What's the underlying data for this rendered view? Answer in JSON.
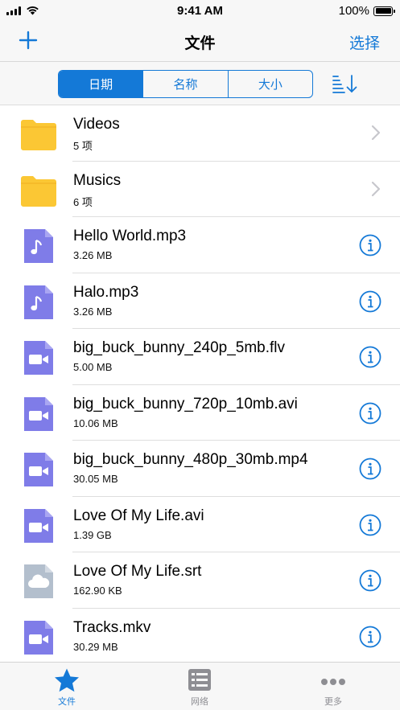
{
  "status_bar": {
    "time": "9:41 AM",
    "battery": "100%"
  },
  "nav": {
    "title": "文件",
    "select_label": "选择",
    "add_icon": "plus-icon"
  },
  "segments": {
    "items": [
      "日期",
      "名称",
      "大小"
    ],
    "active": 0
  },
  "colors": {
    "accent": "#1479d7",
    "folder": "#fbc734",
    "file_purple": "#7f7ce8",
    "subtitle_gray": "#b3bfcd",
    "tab_inactive": "#8e8e93"
  },
  "files": [
    {
      "name": "Videos",
      "detail": "5 项",
      "icon": "folder-icon",
      "action": "chevron-right-icon"
    },
    {
      "name": "Musics",
      "detail": "6 项",
      "icon": "folder-icon",
      "action": "chevron-right-icon"
    },
    {
      "name": "Hello World.mp3",
      "detail": "3.26 MB",
      "icon": "music-file-icon",
      "action": "info-icon"
    },
    {
      "name": "Halo.mp3",
      "detail": "3.26 MB",
      "icon": "music-file-icon",
      "action": "info-icon"
    },
    {
      "name": "big_buck_bunny_240p_5mb.flv",
      "detail": "5.00 MB",
      "icon": "video-file-icon",
      "action": "info-icon"
    },
    {
      "name": "big_buck_bunny_720p_10mb.avi",
      "detail": "10.06 MB",
      "icon": "video-file-icon",
      "action": "info-icon"
    },
    {
      "name": "big_buck_bunny_480p_30mb.mp4",
      "detail": "30.05 MB",
      "icon": "video-file-icon",
      "action": "info-icon"
    },
    {
      "name": "Love Of My Life.avi",
      "detail": "1.39 GB",
      "icon": "video-file-icon",
      "action": "info-icon"
    },
    {
      "name": "Love Of My Life.srt",
      "detail": "162.90 KB",
      "icon": "subtitle-file-icon",
      "action": "info-icon"
    },
    {
      "name": "Tracks.mkv",
      "detail": "30.29 MB",
      "icon": "video-file-icon",
      "action": "info-icon"
    }
  ],
  "tabs": [
    {
      "label": "文件",
      "icon": "star-icon",
      "active": true
    },
    {
      "label": "网络",
      "icon": "list-icon",
      "active": false
    },
    {
      "label": "更多",
      "icon": "more-icon",
      "active": false
    }
  ]
}
